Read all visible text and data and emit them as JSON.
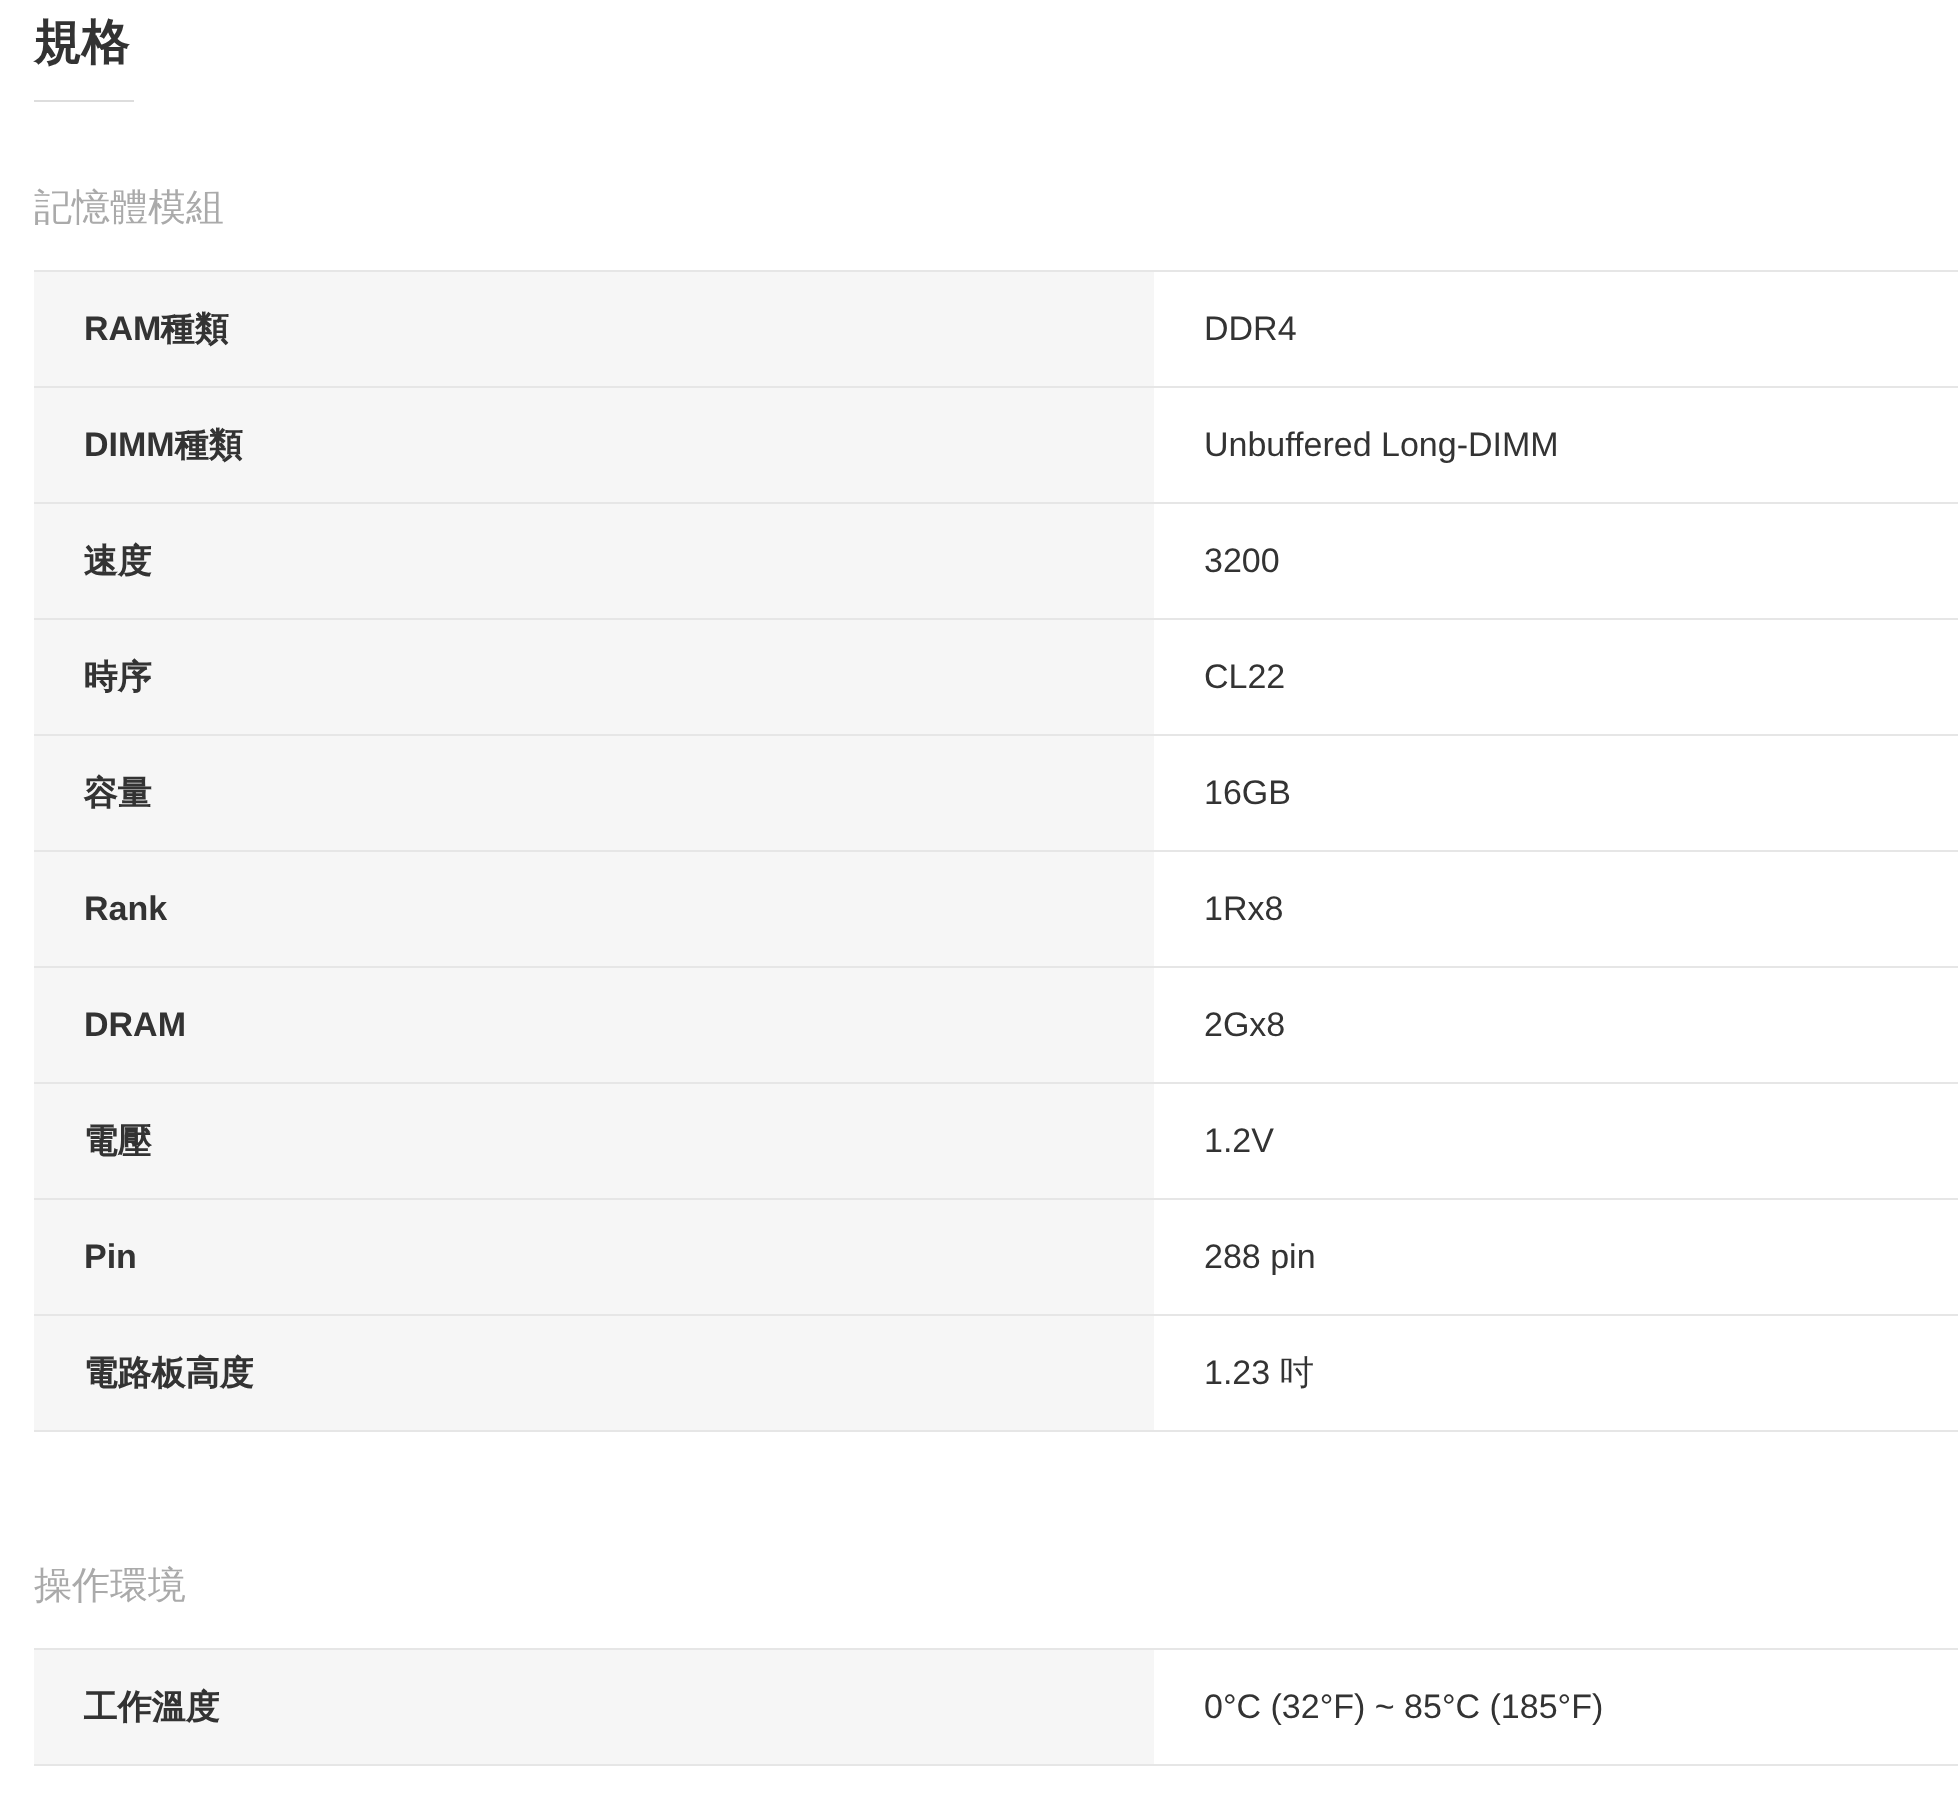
{
  "title": "規格",
  "sections": [
    {
      "heading": "記憶體模組",
      "rows": [
        {
          "label": "RAM種類",
          "value": "DDR4"
        },
        {
          "label": "DIMM種類",
          "value": "Unbuffered Long-DIMM"
        },
        {
          "label": "速度",
          "value": "3200"
        },
        {
          "label": "時序",
          "value": "CL22"
        },
        {
          "label": "容量",
          "value": "16GB"
        },
        {
          "label": "Rank",
          "value": "1Rx8"
        },
        {
          "label": "DRAM",
          "value": "2Gx8"
        },
        {
          "label": "電壓",
          "value": "1.2V"
        },
        {
          "label": "Pin",
          "value": "288 pin"
        },
        {
          "label": "電路板高度",
          "value": "1.23 吋"
        }
      ]
    },
    {
      "heading": "操作環境",
      "rows": [
        {
          "label": "工作溫度",
          "value": "0°C (32°F) ~ 85°C (185°F)"
        }
      ]
    }
  ]
}
